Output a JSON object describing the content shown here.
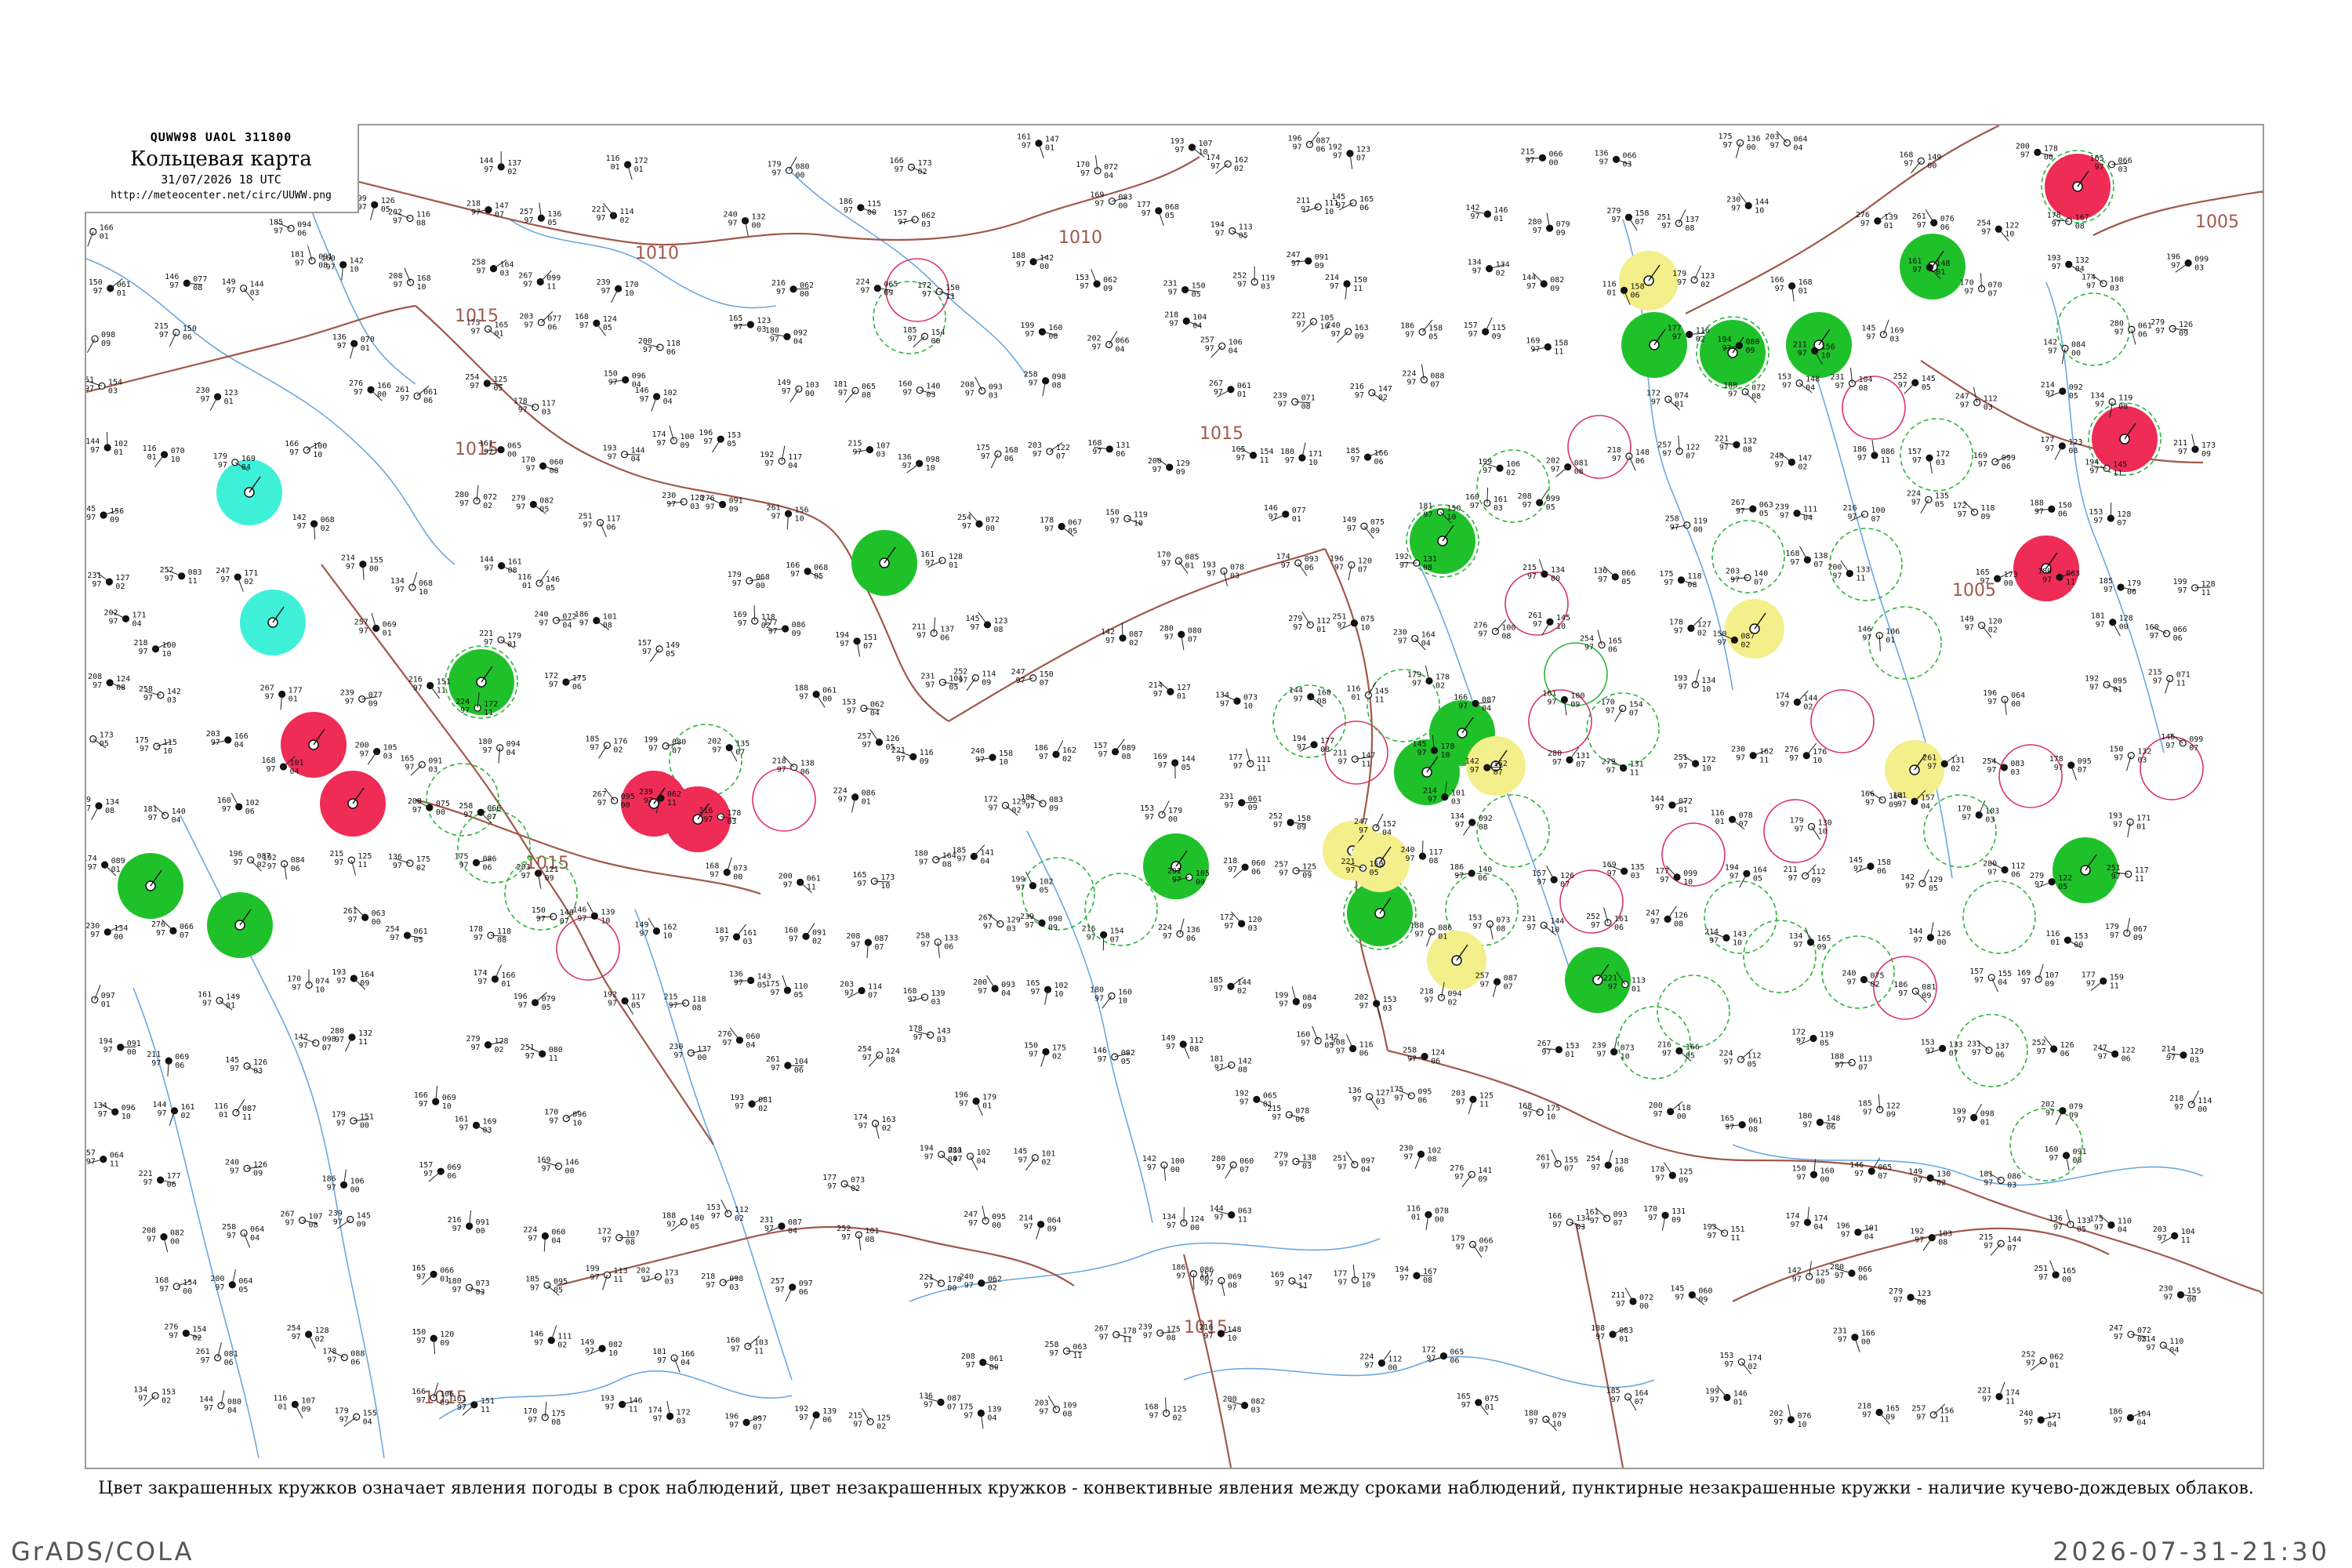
{
  "header": {
    "code": "QUWW98  UAOL  311800",
    "title": "Кольцевая карта",
    "datetime": "31/07/2026 18 UTC",
    "url": "http://meteocenter.net/circ/UUWW.png"
  },
  "caption": "Цвет закрашенных кружков означает явления погоды в срок наблюдений, цвет незакрашенных кружков - конвективные явления между сроками наблюдений, пунктирные незакрашенные кружки - наличие кучево-дождевых облаков.",
  "footer": {
    "left": "GrADS/COLA",
    "right": "2026-07-31-21:30"
  },
  "isobars": [
    {
      "label": "1005"
    },
    {
      "label": "1005"
    },
    {
      "label": "1010"
    },
    {
      "label": "1010"
    },
    {
      "label": "1015"
    },
    {
      "label": "1015"
    },
    {
      "label": "1015"
    },
    {
      "label": "1015"
    },
    {
      "label": "1015"
    },
    {
      "label": "1015"
    }
  ],
  "colors": {
    "rain": "#1fc12a",
    "thunder": "#ee2c55",
    "fog": "#3ff0d8",
    "haze": "#f3ef8a",
    "isobar": "#a0584a",
    "river": "#6aa8e0",
    "convective_ring_green": "#2bb53a",
    "convective_ring_red": "#d8336a"
  },
  "stations": [
    {
      "t": "144",
      "p": "97",
      "name": ""
    },
    {
      "t": "116",
      "p": "01",
      "name": ""
    },
    {
      "t": "179",
      "p": "97",
      "name": ""
    },
    {
      "t": "166",
      "p": "97",
      "name": ""
    },
    {
      "t": "161",
      "p": "97",
      "name": ""
    },
    {
      "t": "170",
      "p": "97",
      "name": ""
    },
    {
      "t": "193",
      "p": "97",
      "name": ""
    },
    {
      "t": "174",
      "p": "97",
      "name": ""
    },
    {
      "t": "196",
      "p": "97",
      "name": ""
    },
    {
      "t": "192",
      "p": "97",
      "name": ""
    },
    {
      "t": "215",
      "p": "97",
      "name": ""
    },
    {
      "t": "136",
      "p": "97",
      "name": ""
    },
    {
      "t": "175",
      "p": "97",
      "name": ""
    },
    {
      "t": "203",
      "p": "97",
      "name": ""
    },
    {
      "t": "168",
      "p": "97",
      "name": ""
    },
    {
      "t": "200",
      "p": "97",
      "name": ""
    },
    {
      "t": "165",
      "p": "97",
      "name": ""
    },
    {
      "t": "180",
      "p": "97",
      "name": ""
    },
    {
      "t": "185",
      "p": "97",
      "name": ""
    },
    {
      "t": "199",
      "p": "97",
      "name": ""
    },
    {
      "t": "202",
      "p": "97",
      "name": ""
    },
    {
      "t": "218",
      "p": "97",
      "name": ""
    },
    {
      "t": "257",
      "p": "97",
      "name": ""
    },
    {
      "t": "221",
      "p": "97",
      "name": ""
    },
    {
      "t": "240",
      "p": "97",
      "name": ""
    },
    {
      "t": "186",
      "p": "97",
      "name": ""
    },
    {
      "t": "157",
      "p": "97",
      "name": ""
    },
    {
      "t": "169",
      "p": "97",
      "name": ""
    },
    {
      "t": "177",
      "p": "97",
      "name": ""
    },
    {
      "t": "194",
      "p": "97",
      "name": ""
    },
    {
      "t": "211",
      "p": "97",
      "name": ""
    },
    {
      "t": "145",
      "p": "97",
      "name": ""
    },
    {
      "t": "142",
      "p": "97",
      "name": ""
    },
    {
      "t": "280",
      "p": "97",
      "name": ""
    },
    {
      "t": "279",
      "p": "97",
      "name": ""
    },
    {
      "t": "251",
      "p": "97",
      "name": ""
    },
    {
      "t": "230",
      "p": "97",
      "name": ""
    },
    {
      "t": "276",
      "p": "97",
      "name": ""
    },
    {
      "t": "261",
      "p": "97",
      "name": ""
    },
    {
      "t": "254",
      "p": "97",
      "name": ""
    },
    {
      "t": "178",
      "p": "97",
      "name": ""
    },
    {
      "t": "150",
      "p": "97",
      "name": ""
    },
    {
      "t": "146",
      "p": "97",
      "name": ""
    },
    {
      "t": "149",
      "p": "97",
      "name": ""
    },
    {
      "t": "181",
      "p": "97",
      "name": ""
    },
    {
      "t": "160",
      "p": "97",
      "name": ""
    },
    {
      "t": "208",
      "p": "97",
      "name": ""
    },
    {
      "t": "258",
      "p": "97",
      "name": ""
    },
    {
      "t": "267",
      "p": "97",
      "name": ""
    },
    {
      "t": "239",
      "p": "97",
      "name": ""
    },
    {
      "t": "216",
      "p": "97",
      "name": ""
    },
    {
      "t": "224",
      "p": "97",
      "name": ""
    },
    {
      "t": "172",
      "p": "97",
      "name": ""
    },
    {
      "t": "188",
      "p": "97",
      "name": ""
    },
    {
      "t": "153",
      "p": "97",
      "name": ""
    },
    {
      "t": "231",
      "p": "97",
      "name": ""
    },
    {
      "t": "252",
      "p": "97",
      "name": ""
    },
    {
      "t": "247",
      "p": "97",
      "name": ""
    },
    {
      "t": "214",
      "p": "97",
      "name": ""
    },
    {
      "t": "134",
      "p": "97",
      "name": ""
    }
  ],
  "weather_circles": [
    {
      "kind": "rain"
    },
    {
      "kind": "rain"
    },
    {
      "kind": "rain"
    },
    {
      "kind": "rain"
    },
    {
      "kind": "rain"
    },
    {
      "kind": "rain"
    },
    {
      "kind": "rain"
    },
    {
      "kind": "rain"
    },
    {
      "kind": "rain"
    },
    {
      "kind": "rain"
    },
    {
      "kind": "rain"
    },
    {
      "kind": "rain"
    },
    {
      "kind": "rain"
    },
    {
      "kind": "rain"
    },
    {
      "kind": "rain"
    },
    {
      "kind": "thunder"
    },
    {
      "kind": "thunder"
    },
    {
      "kind": "thunder"
    },
    {
      "kind": "thunder"
    },
    {
      "kind": "thunder"
    },
    {
      "kind": "thunder"
    },
    {
      "kind": "thunder"
    },
    {
      "kind": "fog"
    },
    {
      "kind": "fog"
    },
    {
      "kind": "haze"
    },
    {
      "kind": "haze"
    },
    {
      "kind": "haze"
    },
    {
      "kind": "haze"
    },
    {
      "kind": "haze"
    },
    {
      "kind": "haze"
    },
    {
      "kind": "haze"
    }
  ]
}
